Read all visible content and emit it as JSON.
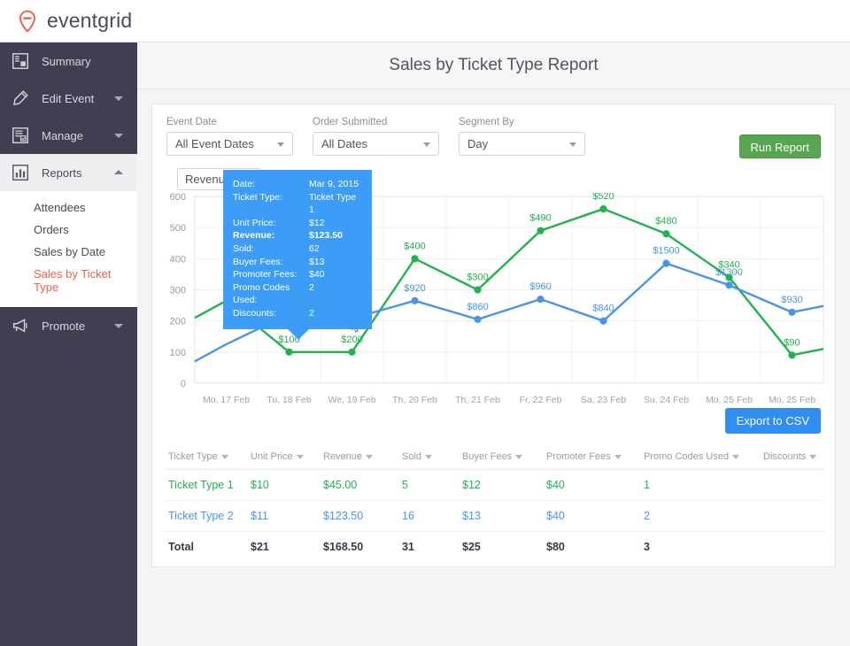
{
  "brand": {
    "name": "eventgrid",
    "logo_icon": "location-pin-icon",
    "logo_color": "#ee6352"
  },
  "sidebar": {
    "items": [
      {
        "label": "Summary",
        "icon": "summary-icon",
        "expandable": false
      },
      {
        "label": "Edit Event",
        "icon": "pencil-icon",
        "expandable": true
      },
      {
        "label": "Manage",
        "icon": "checklist-icon",
        "expandable": true
      },
      {
        "label": "Reports",
        "icon": "bar-chart-icon",
        "expandable": true,
        "expanded": true
      },
      {
        "label": "Promote",
        "icon": "megaphone-icon",
        "expandable": true
      }
    ],
    "reports_submenu": [
      {
        "label": "Attendees",
        "selected": false
      },
      {
        "label": "Orders",
        "selected": false
      },
      {
        "label": "Sales by Date",
        "selected": false
      },
      {
        "label": "Sales by Ticket Type",
        "selected": true
      }
    ],
    "selected_color": "#f2604c"
  },
  "header": {
    "title": "Sales by Ticket Type Report"
  },
  "filters": [
    {
      "label": "Event Date",
      "value": "All Event Dates"
    },
    {
      "label": "Order Submitted",
      "value": "All Dates"
    },
    {
      "label": "Segment By",
      "value": "Day"
    }
  ],
  "buttons": {
    "run_report": "Run Report",
    "run_report_color": "#58a552",
    "export_csv": "Export to CSV",
    "export_csv_color": "#2f8ef0"
  },
  "chart_panel": {
    "metric_select_value": "Revenue"
  },
  "tooltip": {
    "rows": [
      {
        "key": "Date:",
        "value": "Mar 9, 2015",
        "bold": false
      },
      {
        "key": "Ticket Type:",
        "value": "Ticket Type 1",
        "bold": false
      },
      {
        "key": "Unit Price:",
        "value": "$12",
        "bold": false
      },
      {
        "key": "Revenue:",
        "value": "$123.50",
        "bold": true
      },
      {
        "key": "Sold:",
        "value": "62",
        "bold": false
      },
      {
        "key": "Buyer Fees:",
        "value": "$13",
        "bold": false
      },
      {
        "key": "Promoter Fees:",
        "value": "$40",
        "bold": false
      },
      {
        "key": "Promo Codes Used:",
        "value": "2",
        "bold": false
      },
      {
        "key": "Discounts:",
        "value": "2",
        "bold": false
      }
    ],
    "background": "#3d9cf5"
  },
  "chart_data": {
    "type": "line",
    "title": "",
    "xlabel": "",
    "ylabel": "",
    "ylim": [
      0,
      600
    ],
    "yticks": [
      0,
      100,
      200,
      300,
      400,
      500,
      600
    ],
    "grid": true,
    "legend": "none",
    "categories": [
      "Mo, 17 Feb",
      "Tu, 18 Feb",
      "We, 19 Feb",
      "Th, 20 Feb",
      "Th, 21 Feb",
      "Fr, 22 Feb",
      "Sa, 23 Feb",
      "Su, 24 Feb",
      "Mo, 25 Feb",
      "Mo, 25 Feb"
    ],
    "series": [
      {
        "name": "Ticket Type 1",
        "color": "#23b24d",
        "values": [
          265,
          100,
          100,
          400,
          300,
          490,
          560,
          480,
          340,
          90
        ],
        "labels": [
          "",
          "$100",
          "$200",
          "$400",
          "$300",
          "$490",
          "$520",
          "$480",
          "$340",
          "$90"
        ]
      },
      {
        "name": "Ticket Type 2",
        "color": "#4a94e8",
        "values": [
          125,
          222,
          208,
          265,
          205,
          270,
          200,
          385,
          315,
          228
        ],
        "labels": [
          "",
          "$1500",
          "",
          "$920",
          "$860",
          "$960",
          "$840",
          "$1500",
          "$1300",
          "$930"
        ],
        "hover_index": 2
      }
    ]
  },
  "table": {
    "columns": [
      "Ticket Type",
      "Unit Price",
      "Revenue",
      "Sold",
      "Buyer Fees",
      "Promoter Fees",
      "Promo Codes Used",
      "Discounts"
    ],
    "rows": [
      {
        "style": "row-green",
        "cells": [
          "Ticket Type 1",
          "$10",
          "$45.00",
          "5",
          "$12",
          "$40",
          "1",
          ""
        ]
      },
      {
        "style": "row-blue",
        "cells": [
          "Ticket Type 2",
          "$11",
          "$123.50",
          "16",
          "$13",
          "$40",
          "2",
          ""
        ]
      },
      {
        "style": "row-total",
        "cells": [
          "Total",
          "$21",
          "$168.50",
          "31",
          "$25",
          "$80",
          "3",
          ""
        ]
      }
    ]
  }
}
